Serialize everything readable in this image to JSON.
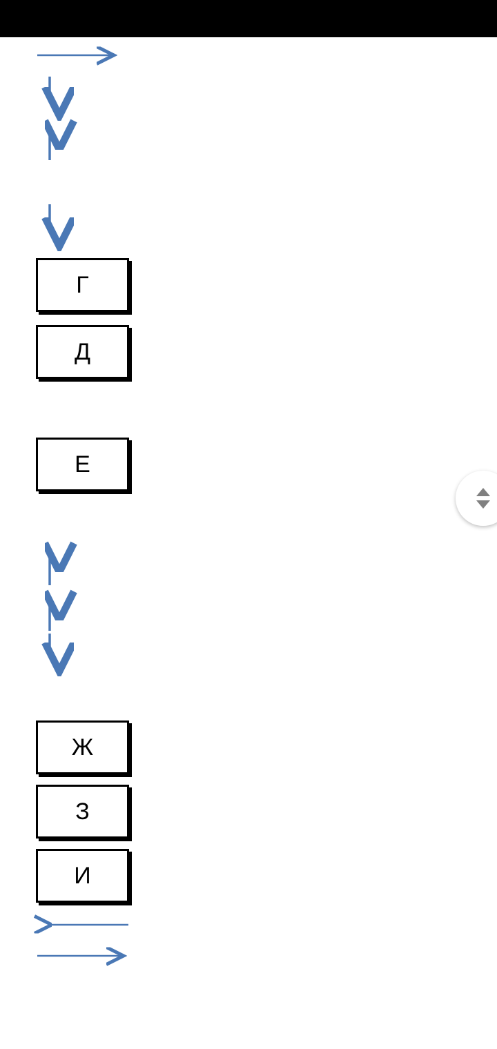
{
  "arrow_color": "#4A78B5",
  "boxes": {
    "b1": "Г",
    "b2": "Д",
    "b3": "Е",
    "b4": "Ж",
    "b5": "З",
    "b6": "И"
  }
}
